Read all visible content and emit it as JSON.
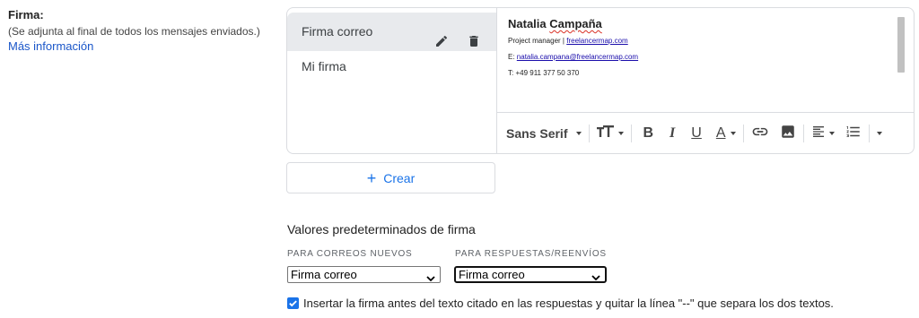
{
  "section": {
    "title": "Firma:",
    "note": "(Se adjunta al final de todos los mensajes enviados.)",
    "more_info_link": "Más información"
  },
  "signatures": [
    {
      "name": "Firma correo",
      "selected": true
    },
    {
      "name": "Mi firma",
      "selected": false
    }
  ],
  "editor": {
    "name_first": "Natalia",
    "name_last": "Campaña",
    "role": "Project manager |",
    "website": "freelancermap.com",
    "email_label": "E:",
    "email": "natalia.campana@freelancermap.com",
    "phone": "T: +49 911 377 50 370"
  },
  "toolbar": {
    "font": "Sans Serif",
    "icons": [
      "text-size-icon",
      "bold-icon",
      "italic-icon",
      "underline-icon",
      "text-color-icon",
      "link-icon",
      "image-icon",
      "align-icon",
      "numbered-list-icon",
      "more-icon"
    ],
    "bold_label": "B",
    "italic_label": "I",
    "underline_label": "U",
    "color_label": "A"
  },
  "create_button": {
    "icon": "plus-icon",
    "label": "Crear"
  },
  "defaults": {
    "title": "Valores predeterminados de firma",
    "new_label": "PARA CORREOS NUEVOS",
    "new_value": "Firma correo",
    "reply_label": "PARA RESPUESTAS/REENVÍOS",
    "reply_value": "Firma correo"
  },
  "insert_checkbox": {
    "checked": true,
    "label": "Insertar la firma antes del texto citado en las respuestas y quitar la línea \"--\" que separa los dos textos."
  },
  "colors": {
    "accent": "#1a73e8",
    "link": "#1a56c9",
    "selected_bg": "#e8eaed",
    "border": "#dadce0"
  }
}
